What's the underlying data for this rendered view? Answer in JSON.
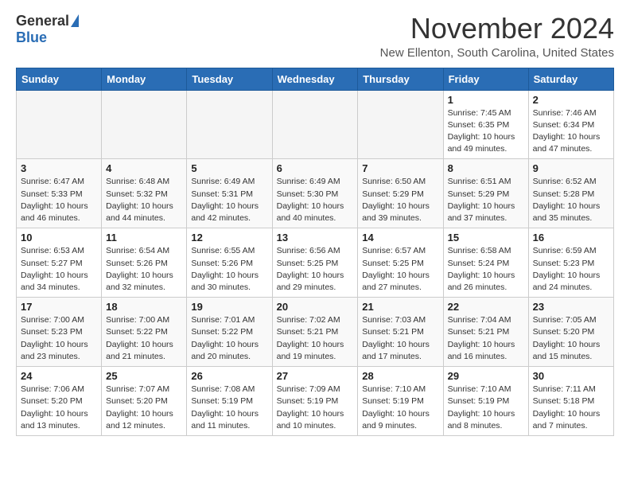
{
  "header": {
    "logo_general": "General",
    "logo_blue": "Blue",
    "month_title": "November 2024",
    "location": "New Ellenton, South Carolina, United States"
  },
  "columns": [
    "Sunday",
    "Monday",
    "Tuesday",
    "Wednesday",
    "Thursday",
    "Friday",
    "Saturday"
  ],
  "weeks": [
    [
      {
        "day": "",
        "info": ""
      },
      {
        "day": "",
        "info": ""
      },
      {
        "day": "",
        "info": ""
      },
      {
        "day": "",
        "info": ""
      },
      {
        "day": "",
        "info": ""
      },
      {
        "day": "1",
        "info": "Sunrise: 7:45 AM\nSunset: 6:35 PM\nDaylight: 10 hours and 49 minutes."
      },
      {
        "day": "2",
        "info": "Sunrise: 7:46 AM\nSunset: 6:34 PM\nDaylight: 10 hours and 47 minutes."
      }
    ],
    [
      {
        "day": "3",
        "info": "Sunrise: 6:47 AM\nSunset: 5:33 PM\nDaylight: 10 hours and 46 minutes."
      },
      {
        "day": "4",
        "info": "Sunrise: 6:48 AM\nSunset: 5:32 PM\nDaylight: 10 hours and 44 minutes."
      },
      {
        "day": "5",
        "info": "Sunrise: 6:49 AM\nSunset: 5:31 PM\nDaylight: 10 hours and 42 minutes."
      },
      {
        "day": "6",
        "info": "Sunrise: 6:49 AM\nSunset: 5:30 PM\nDaylight: 10 hours and 40 minutes."
      },
      {
        "day": "7",
        "info": "Sunrise: 6:50 AM\nSunset: 5:29 PM\nDaylight: 10 hours and 39 minutes."
      },
      {
        "day": "8",
        "info": "Sunrise: 6:51 AM\nSunset: 5:29 PM\nDaylight: 10 hours and 37 minutes."
      },
      {
        "day": "9",
        "info": "Sunrise: 6:52 AM\nSunset: 5:28 PM\nDaylight: 10 hours and 35 minutes."
      }
    ],
    [
      {
        "day": "10",
        "info": "Sunrise: 6:53 AM\nSunset: 5:27 PM\nDaylight: 10 hours and 34 minutes."
      },
      {
        "day": "11",
        "info": "Sunrise: 6:54 AM\nSunset: 5:26 PM\nDaylight: 10 hours and 32 minutes."
      },
      {
        "day": "12",
        "info": "Sunrise: 6:55 AM\nSunset: 5:26 PM\nDaylight: 10 hours and 30 minutes."
      },
      {
        "day": "13",
        "info": "Sunrise: 6:56 AM\nSunset: 5:25 PM\nDaylight: 10 hours and 29 minutes."
      },
      {
        "day": "14",
        "info": "Sunrise: 6:57 AM\nSunset: 5:25 PM\nDaylight: 10 hours and 27 minutes."
      },
      {
        "day": "15",
        "info": "Sunrise: 6:58 AM\nSunset: 5:24 PM\nDaylight: 10 hours and 26 minutes."
      },
      {
        "day": "16",
        "info": "Sunrise: 6:59 AM\nSunset: 5:23 PM\nDaylight: 10 hours and 24 minutes."
      }
    ],
    [
      {
        "day": "17",
        "info": "Sunrise: 7:00 AM\nSunset: 5:23 PM\nDaylight: 10 hours and 23 minutes."
      },
      {
        "day": "18",
        "info": "Sunrise: 7:00 AM\nSunset: 5:22 PM\nDaylight: 10 hours and 21 minutes."
      },
      {
        "day": "19",
        "info": "Sunrise: 7:01 AM\nSunset: 5:22 PM\nDaylight: 10 hours and 20 minutes."
      },
      {
        "day": "20",
        "info": "Sunrise: 7:02 AM\nSunset: 5:21 PM\nDaylight: 10 hours and 19 minutes."
      },
      {
        "day": "21",
        "info": "Sunrise: 7:03 AM\nSunset: 5:21 PM\nDaylight: 10 hours and 17 minutes."
      },
      {
        "day": "22",
        "info": "Sunrise: 7:04 AM\nSunset: 5:21 PM\nDaylight: 10 hours and 16 minutes."
      },
      {
        "day": "23",
        "info": "Sunrise: 7:05 AM\nSunset: 5:20 PM\nDaylight: 10 hours and 15 minutes."
      }
    ],
    [
      {
        "day": "24",
        "info": "Sunrise: 7:06 AM\nSunset: 5:20 PM\nDaylight: 10 hours and 13 minutes."
      },
      {
        "day": "25",
        "info": "Sunrise: 7:07 AM\nSunset: 5:20 PM\nDaylight: 10 hours and 12 minutes."
      },
      {
        "day": "26",
        "info": "Sunrise: 7:08 AM\nSunset: 5:19 PM\nDaylight: 10 hours and 11 minutes."
      },
      {
        "day": "27",
        "info": "Sunrise: 7:09 AM\nSunset: 5:19 PM\nDaylight: 10 hours and 10 minutes."
      },
      {
        "day": "28",
        "info": "Sunrise: 7:10 AM\nSunset: 5:19 PM\nDaylight: 10 hours and 9 minutes."
      },
      {
        "day": "29",
        "info": "Sunrise: 7:10 AM\nSunset: 5:19 PM\nDaylight: 10 hours and 8 minutes."
      },
      {
        "day": "30",
        "info": "Sunrise: 7:11 AM\nSunset: 5:18 PM\nDaylight: 10 hours and 7 minutes."
      }
    ]
  ]
}
